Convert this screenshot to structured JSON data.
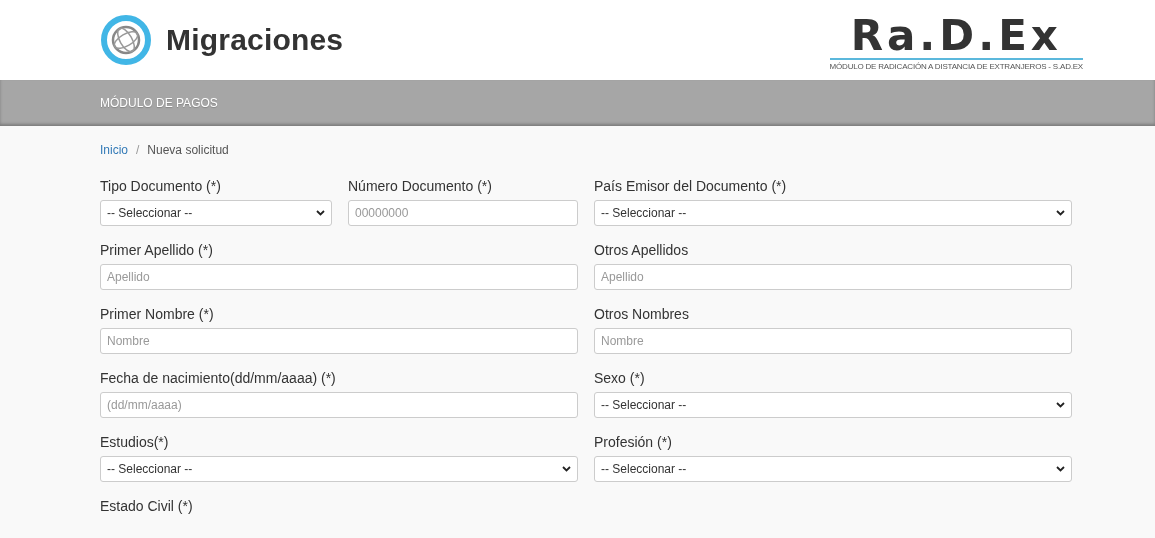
{
  "header": {
    "brand": "Migraciones",
    "radex_logo": "Ra.D.Ex",
    "radex_subtitle": "MÓDULO DE RADICACIÓN A DISTANCIA DE EXTRANJEROS - S.AD.EX"
  },
  "nav_bar": {
    "title": "MÓDULO DE PAGOS"
  },
  "breadcrumb": {
    "separator": "/",
    "items": [
      {
        "label": "Inicio",
        "kind": "link"
      },
      {
        "label": "Nueva solicitud",
        "kind": "current"
      }
    ]
  },
  "form": {
    "rows": [
      {
        "fields": [
          {
            "label": "Tipo Documento (*)",
            "kind": "select",
            "value": "-- Seleccionar --"
          },
          {
            "label": "Número Documento (*)",
            "kind": "text",
            "placeholder": "00000000"
          },
          {
            "label": "País Emisor del Documento (*)",
            "kind": "select",
            "value": "-- Seleccionar --"
          }
        ]
      },
      {
        "fields": [
          {
            "label": "Primer Apellido (*)",
            "kind": "text",
            "placeholder": "Apellido"
          },
          {
            "label": "Otros Apellidos",
            "kind": "text",
            "placeholder": "Apellido"
          }
        ]
      },
      {
        "fields": [
          {
            "label": "Primer Nombre (*)",
            "kind": "text",
            "placeholder": "Nombre"
          },
          {
            "label": "Otros Nombres",
            "kind": "text",
            "placeholder": "Nombre"
          }
        ]
      },
      {
        "fields": [
          {
            "label": "Fecha de nacimiento(dd/mm/aaaa) (*)",
            "kind": "text",
            "placeholder": "(dd/mm/aaaa)"
          },
          {
            "label": "Sexo (*)",
            "kind": "select",
            "value": "-- Seleccionar --"
          }
        ]
      },
      {
        "fields": [
          {
            "label": "Estudios(*)",
            "kind": "select",
            "value": "-- Seleccionar --"
          },
          {
            "label": "Profesión (*)",
            "kind": "select",
            "value": "-- Seleccionar --"
          }
        ]
      },
      {
        "fields": [
          {
            "label": "Estado Civil (*)"
          }
        ]
      }
    ]
  }
}
